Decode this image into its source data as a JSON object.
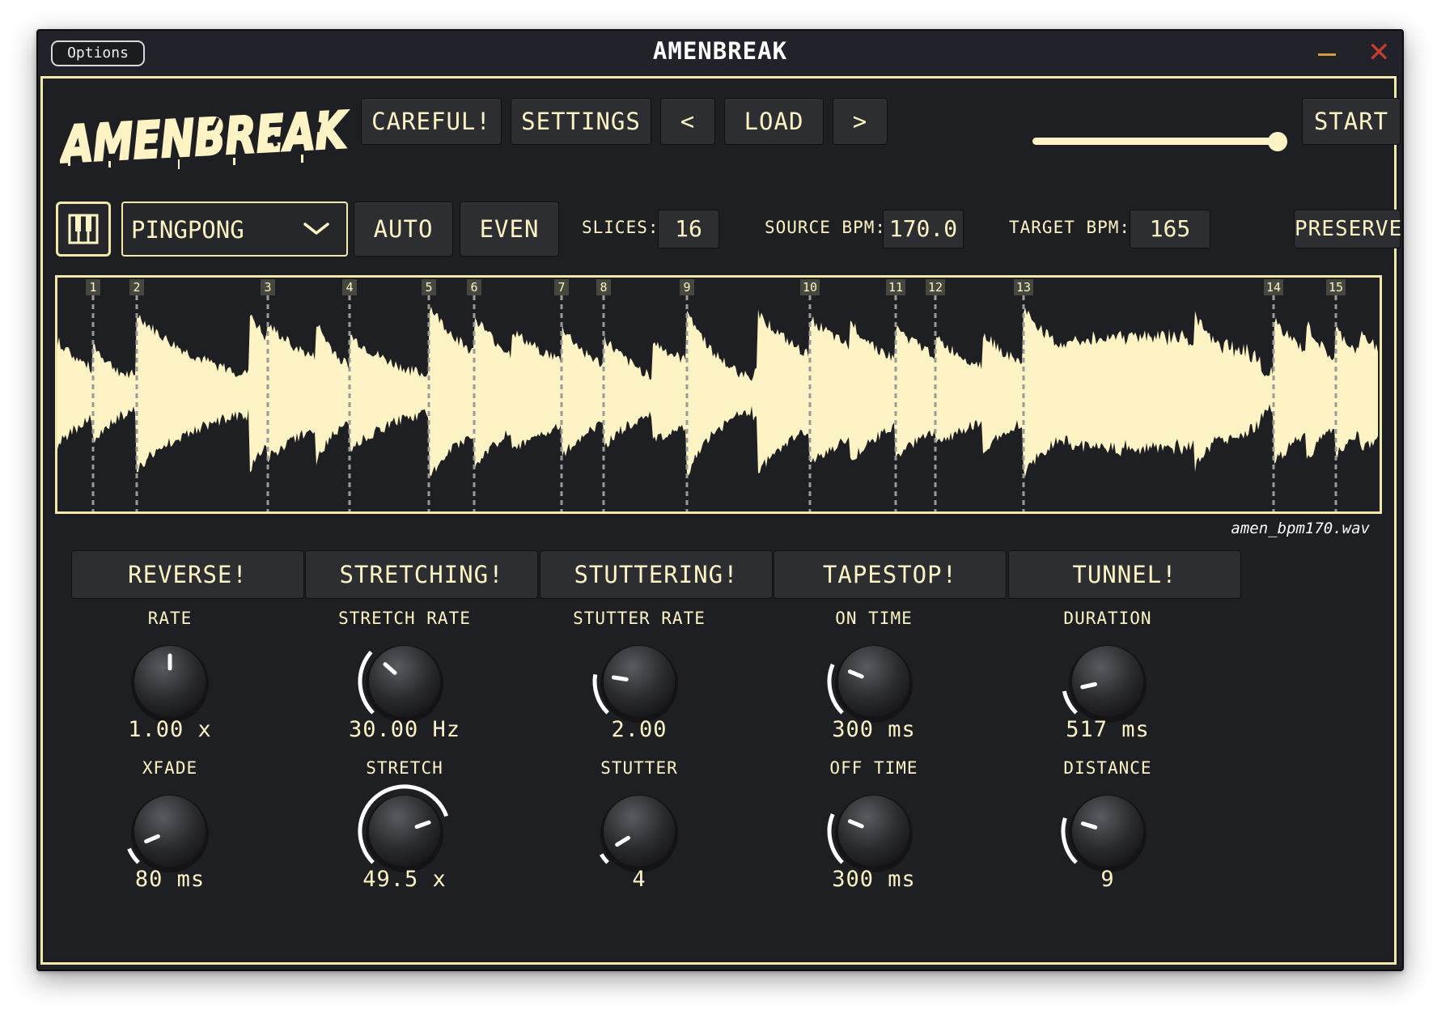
{
  "window": {
    "options_label": "Options",
    "title": "AMENBREAK"
  },
  "logo_text": "AMENBREAK",
  "header": {
    "careful_label": "CAREFUL!",
    "settings_label": "SETTINGS",
    "prev_label": "<",
    "load_label": "LOAD",
    "next_label": ">",
    "start_label": "START",
    "slider_value": 1.0
  },
  "controls": {
    "mode": "PINGPONG",
    "auto_label": "AUTO",
    "even_label": "EVEN",
    "slices_label": "SLICES:",
    "slices_value": "16",
    "source_bpm_label": "SOURCE BPM:",
    "source_bpm_value": "170.0",
    "target_bpm_label": "TARGET BPM:",
    "target_bpm_value": "165",
    "preserve_label": "PRESERVE"
  },
  "waveform": {
    "filename": "amen_bpm170.wav",
    "markers": [
      {
        "label": "1",
        "pos": 0.027
      },
      {
        "label": "2",
        "pos": 0.06
      },
      {
        "label": "3",
        "pos": 0.159
      },
      {
        "label": "4",
        "pos": 0.221
      },
      {
        "label": "5",
        "pos": 0.281
      },
      {
        "label": "6",
        "pos": 0.315
      },
      {
        "label": "7",
        "pos": 0.381
      },
      {
        "label": "8",
        "pos": 0.413
      },
      {
        "label": "9",
        "pos": 0.476
      },
      {
        "label": "10",
        "pos": 0.569
      },
      {
        "label": "11",
        "pos": 0.634
      },
      {
        "label": "12",
        "pos": 0.664
      },
      {
        "label": "13",
        "pos": 0.731
      },
      {
        "label": "14",
        "pos": 0.92
      },
      {
        "label": "15",
        "pos": 0.967
      }
    ]
  },
  "effects": [
    {
      "button": "REVERSE!",
      "knobs": [
        {
          "label": "RATE",
          "value": "1.00 x",
          "level": 0.5,
          "arc": false
        },
        {
          "label": "XFADE",
          "value": "80 ms",
          "level": 0.08,
          "arc": true
        }
      ]
    },
    {
      "button": "STRETCHING!",
      "knobs": [
        {
          "label": "STRETCH RATE",
          "value": "30.00 Hz",
          "level": 0.32,
          "arc": true
        },
        {
          "label": "STRETCH",
          "value": "49.5 x",
          "level": 0.76,
          "arc": true
        }
      ]
    },
    {
      "button": "STUTTERING!",
      "knobs": [
        {
          "label": "STUTTER RATE",
          "value": "2.00",
          "level": 0.2,
          "arc": true
        },
        {
          "label": "STUTTER",
          "value": "4",
          "level": 0.05,
          "arc": true
        }
      ]
    },
    {
      "button": "TAPESTOP!",
      "knobs": [
        {
          "label": "ON TIME",
          "value": "300 ms",
          "level": 0.25,
          "arc": true
        },
        {
          "label": "OFF TIME",
          "value": "300 ms",
          "level": 0.25,
          "arc": true
        }
      ]
    },
    {
      "button": "TUNNEL!",
      "knobs": [
        {
          "label": "DURATION",
          "value": "517 ms",
          "level": 0.12,
          "arc": true
        },
        {
          "label": "DISTANCE",
          "value": "9",
          "level": 0.23,
          "arc": true
        }
      ]
    }
  ],
  "colors": {
    "accent": "#fdf3c4",
    "background": "#1e1f23",
    "button": "#2d2e31",
    "close": "#c8392f",
    "minimize": "#d39a3c"
  },
  "icons": {
    "midi": "piano-keys-icon",
    "dropdown": "chevron-down-icon",
    "close": "close-icon",
    "minimize": "minimize-icon"
  }
}
